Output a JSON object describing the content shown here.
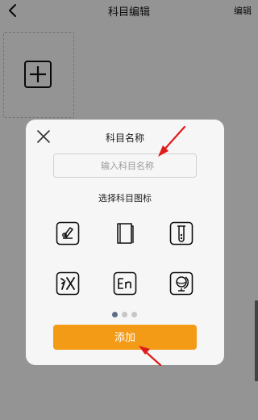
{
  "header": {
    "title": "科目编辑",
    "edit_label": "编辑"
  },
  "modal": {
    "title": "科目名称",
    "input": {
      "value": "",
      "placeholder": "输入科目名称"
    },
    "icon_section_label": "选择科目图标",
    "icons": [
      {
        "name": "microscope-icon"
      },
      {
        "name": "book-icon"
      },
      {
        "name": "test-tube-icon"
      },
      {
        "name": "chinese-character-icon"
      },
      {
        "name": "english-en-icon",
        "text": "En"
      },
      {
        "name": "globe-icon"
      }
    ],
    "pager": {
      "pages": 3,
      "current": 1
    },
    "add_label": "添加"
  },
  "colors": {
    "accent": "#f39a17",
    "annotation": "#e01b1b",
    "pager_active": "#5d6d86"
  }
}
